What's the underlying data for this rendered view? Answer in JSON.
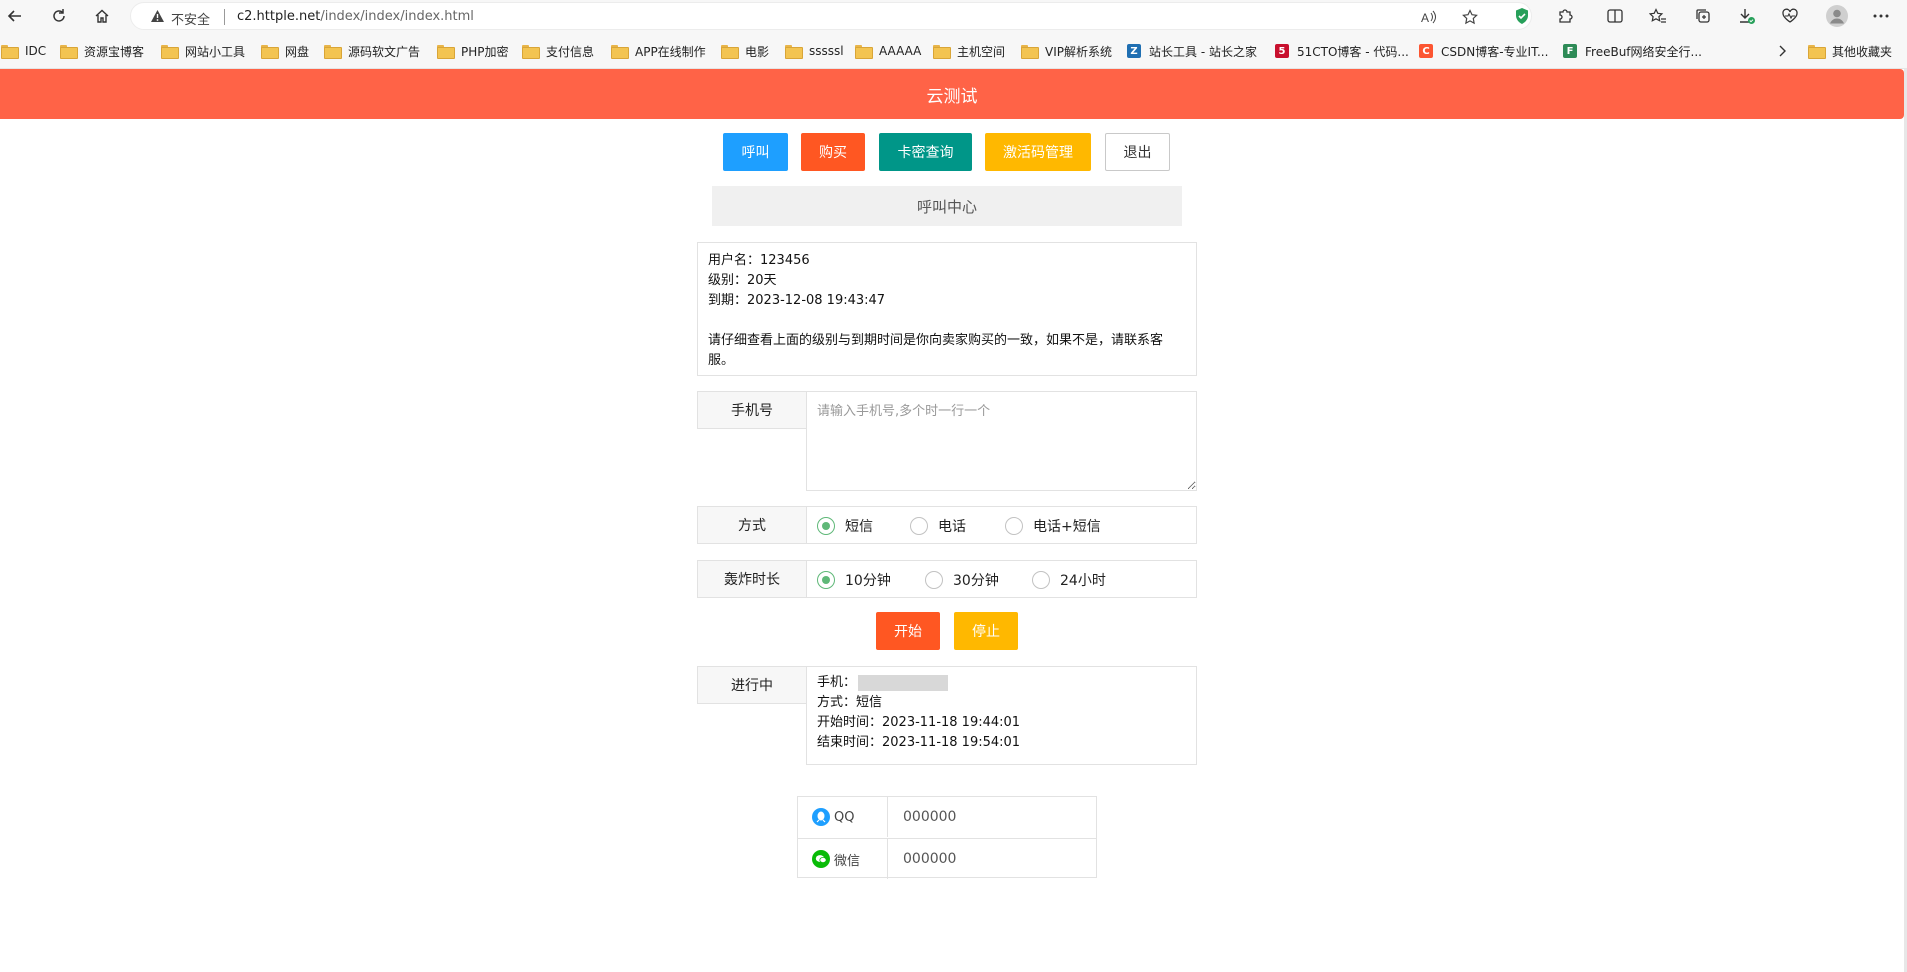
{
  "browser": {
    "insecure_label": "不安全",
    "url_host": "c2.httple.net",
    "url_path": "/index/index/index.html"
  },
  "bookmarks": [
    {
      "label": "IDC",
      "icon": "folder-icon"
    },
    {
      "label": "资源宝博客",
      "icon": "folder-icon"
    },
    {
      "label": "网站小工具",
      "icon": "folder-icon"
    },
    {
      "label": "网盘",
      "icon": "folder-icon"
    },
    {
      "label": "源码软文广告",
      "icon": "folder-icon"
    },
    {
      "label": "PHP加密",
      "icon": "folder-icon"
    },
    {
      "label": "支付信息",
      "icon": "folder-icon"
    },
    {
      "label": "APP在线制作",
      "icon": "folder-icon"
    },
    {
      "label": "电影",
      "icon": "folder-icon"
    },
    {
      "label": "sssssl",
      "icon": "folder-icon"
    },
    {
      "label": "AAAAA",
      "icon": "folder-icon"
    },
    {
      "label": "主机空间",
      "icon": "folder-icon"
    },
    {
      "label": "VIP解析系统",
      "icon": "folder-icon"
    },
    {
      "label": "站长工具 - 站长之家",
      "icon": "chinaz-icon"
    },
    {
      "label": "51CTO博客 - 代码...",
      "icon": "51cto-icon"
    },
    {
      "label": "CSDN博客-专业IT...",
      "icon": "csdn-icon"
    },
    {
      "label": "FreeBuf网络安全行...",
      "icon": "freebuf-icon"
    },
    {
      "label": "其他收藏夹",
      "icon": "folder-icon"
    }
  ],
  "page": {
    "title": "云测试",
    "nav": {
      "call": "呼叫",
      "buy": "购买",
      "card_query": "卡密查询",
      "activation": "激活码管理",
      "logout": "退出"
    },
    "section_title": "呼叫中心",
    "account": {
      "username_line": "用户名：123456",
      "level_line": "级别：20天",
      "expiry_line": "到期：2023-12-08 19:43:47",
      "notice": "请仔细查看上面的级别与到期时间是你向卖家购买的一致，如果不是，请联系客服。"
    },
    "form": {
      "phone_label": "手机号",
      "phone_placeholder": "请输入手机号,多个时一行一个",
      "phone_value": "",
      "mode_label": "方式",
      "mode_options": [
        "短信",
        "电话",
        "电话+短信"
      ],
      "mode_selected": "短信",
      "duration_label": "轰炸时长",
      "duration_options": [
        "10分钟",
        "30分钟",
        "24小时"
      ],
      "duration_selected": "10分钟"
    },
    "actions": {
      "start": "开始",
      "stop": "停止"
    },
    "progress": {
      "label": "进行中",
      "phone_line": "手机：",
      "mode_line": "方式：短信",
      "start_line": "开始时间：2023-11-18 19:44:01",
      "end_line": "结束时间：2023-11-18 19:54:01"
    },
    "contact": {
      "qq_label": "QQ",
      "qq_value": "000000",
      "wechat_label": "微信",
      "wechat_value": "000000"
    }
  },
  "colors": {
    "header": "#ff6347",
    "blue": "#1e9fff",
    "red": "#ff5722",
    "teal": "#009688",
    "amber": "#ffb800",
    "radio_on": "#5fb878"
  }
}
